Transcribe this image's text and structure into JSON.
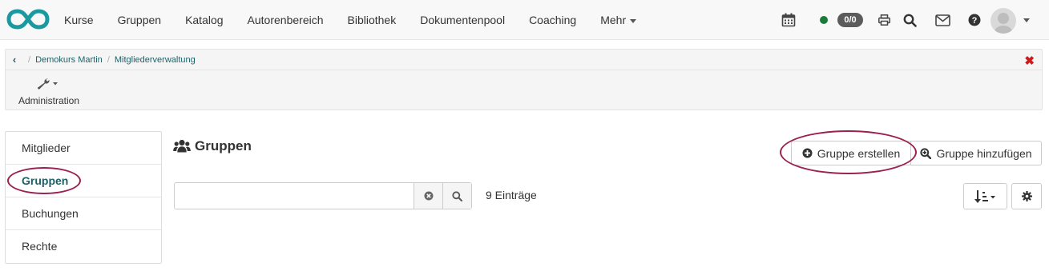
{
  "nav": {
    "items": [
      "Kurse",
      "Gruppen",
      "Katalog",
      "Autorenbereich",
      "Bibliothek",
      "Dokumentenpool",
      "Coaching"
    ],
    "more_label": "Mehr",
    "badge": "0/0"
  },
  "breadcrumb": {
    "items": [
      "Demokurs Martin",
      "Mitgliederverwaltung"
    ]
  },
  "toolbar": {
    "admin_label": "Administration"
  },
  "sidebar": {
    "items": [
      {
        "label": "Mitglieder"
      },
      {
        "label": "Gruppen"
      },
      {
        "label": "Buchungen"
      },
      {
        "label": "Rechte"
      }
    ]
  },
  "main": {
    "title": "Gruppen",
    "create_label": "Gruppe erstellen",
    "add_label": "Gruppe hinzufügen",
    "search_value": "",
    "entries": "9 Einträge"
  },
  "colors": {
    "accent": "#1d5f66",
    "highlight_oval": "#9a2150",
    "close": "#d31818",
    "status": "#1a7a3a"
  }
}
